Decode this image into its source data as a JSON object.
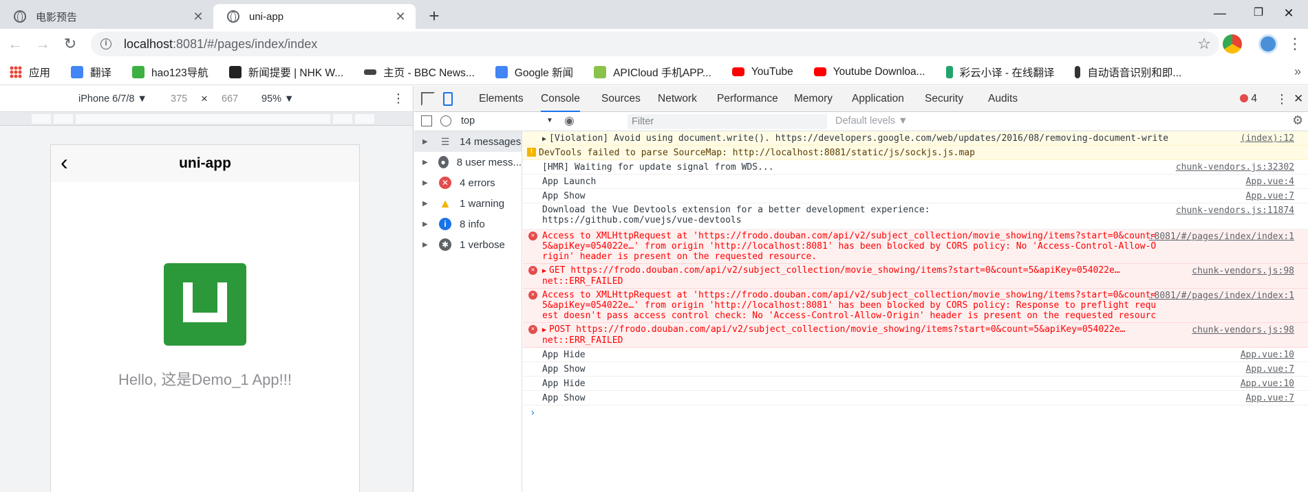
{
  "browser": {
    "tabs": [
      {
        "title": "电影预告",
        "active": false
      },
      {
        "title": "uni-app",
        "active": true
      }
    ],
    "new_tab": "+",
    "window_controls": [
      "—",
      "❐",
      "✕"
    ],
    "url_host": "localhost",
    "url_rest": ":8081/#/pages/index/index"
  },
  "bookmarks": [
    {
      "label": "应用",
      "icon": "apps-grid-icon"
    },
    {
      "label": "翻译",
      "icon": "translate-icon"
    },
    {
      "label": "hao123导航",
      "icon": "hao123-icon"
    },
    {
      "label": "新闻提要 | NHK W...",
      "icon": "nhk-icon"
    },
    {
      "label": "主页 - BBC News...",
      "icon": "bbc-icon"
    },
    {
      "label": "Google 新闻",
      "icon": "google-news-icon"
    },
    {
      "label": "APICloud 手机APP...",
      "icon": "apicloud-icon"
    },
    {
      "label": "YouTube",
      "icon": "youtube-icon"
    },
    {
      "label": "Youtube Downloa...",
      "icon": "youtube-icon"
    },
    {
      "label": "彩云小译 - 在线翻译",
      "icon": "caiyun-icon"
    },
    {
      "label": "自动语音识别和即...",
      "icon": "microphone-icon"
    }
  ],
  "bookmarks_more": "»",
  "device_toolbar": {
    "device": "iPhone 6/7/8 ▼",
    "width": "375",
    "times": "×",
    "height": "667",
    "zoom": "95% ▼",
    "more": "⋮"
  },
  "phone": {
    "nav_title": "uni-app",
    "back": "‹",
    "hello": "Hello, 这是Demo_1 App!!!"
  },
  "devtools": {
    "tabs": [
      "Elements",
      "Console",
      "Sources",
      "Network",
      "Performance",
      "Memory",
      "Application",
      "Security",
      "Audits"
    ],
    "active_tab": "Console",
    "error_count": "4",
    "context": "top",
    "filter_placeholder": "Filter",
    "levels": "Default levels ▼",
    "sidebar": [
      {
        "label": "14 messages",
        "icon": "list-icon",
        "color": "#5f6368"
      },
      {
        "label": "8 user mess...",
        "icon": "user-icon",
        "color": "#5f6368"
      },
      {
        "label": "4 errors",
        "icon": "error-icon",
        "color": "#e34c4c"
      },
      {
        "label": "1 warning",
        "icon": "warning-icon",
        "color": "#f4b400"
      },
      {
        "label": "8 info",
        "icon": "info-icon",
        "color": "#1a73e8"
      },
      {
        "label": "1 verbose",
        "icon": "bug-icon",
        "color": "#5f6368"
      }
    ],
    "messages": [
      {
        "type": "violation",
        "expand": true,
        "text": "[Violation] Avoid using document.write(). https://developers.google.com/web/updates/2016/08/removing-document-write",
        "source": "(index):12"
      },
      {
        "type": "warning",
        "text": "DevTools failed to parse SourceMap: http://localhost:8081/static/js/sockjs.js.map",
        "source": ""
      },
      {
        "type": "log",
        "text": "[HMR] Waiting for update signal from WDS...",
        "source": "chunk-vendors.js:32302"
      },
      {
        "type": "log",
        "text": "App Launch",
        "source": "App.vue:4"
      },
      {
        "type": "log",
        "text": "App Show",
        "source": "App.vue:7"
      },
      {
        "type": "log",
        "text": "Download the Vue Devtools extension for a better development experience:\nhttps://github.com/vuejs/vue-devtools",
        "source": "chunk-vendors.js:11874"
      },
      {
        "type": "error",
        "text": "Access to XMLHttpRequest at 'https://frodo.douban.com/api/v2/subject_collection/movie_showing/items?start=0&count=5&apiKey=054022e…' from origin 'http://localhost:8081' has been blocked by CORS policy: No 'Access-Control-Allow-Origin' header is present on the requested resource.",
        "source": ":8081/#/pages/index/index:1"
      },
      {
        "type": "error",
        "expand": true,
        "text": "GET https://frodo.douban.com/api/v2/subject_collection/movie_showing/items?start=0&count=5&apiKey=054022e…\nnet::ERR_FAILED",
        "source": "chunk-vendors.js:98"
      },
      {
        "type": "error",
        "text": "Access to XMLHttpRequest at 'https://frodo.douban.com/api/v2/subject_collection/movie_showing/items?start=0&count=5&apiKey=054022e…' from origin 'http://localhost:8081' has been blocked by CORS policy: Response to preflight request doesn't pass access control check: No 'Access-Control-Allow-Origin' header is present on the requested resource.",
        "source": ":8081/#/pages/index/index:1"
      },
      {
        "type": "error",
        "expand": true,
        "text": "POST https://frodo.douban.com/api/v2/subject_collection/movie_showing/items?start=0&count=5&apiKey=054022e…\nnet::ERR_FAILED",
        "source": "chunk-vendors.js:98"
      },
      {
        "type": "log",
        "text": "App Hide",
        "source": "App.vue:10"
      },
      {
        "type": "log",
        "text": "App Show",
        "source": "App.vue:7"
      },
      {
        "type": "log",
        "text": "App Hide",
        "source": "App.vue:10"
      },
      {
        "type": "log",
        "text": "App Show",
        "source": "App.vue:7"
      }
    ],
    "prompt": "›"
  }
}
